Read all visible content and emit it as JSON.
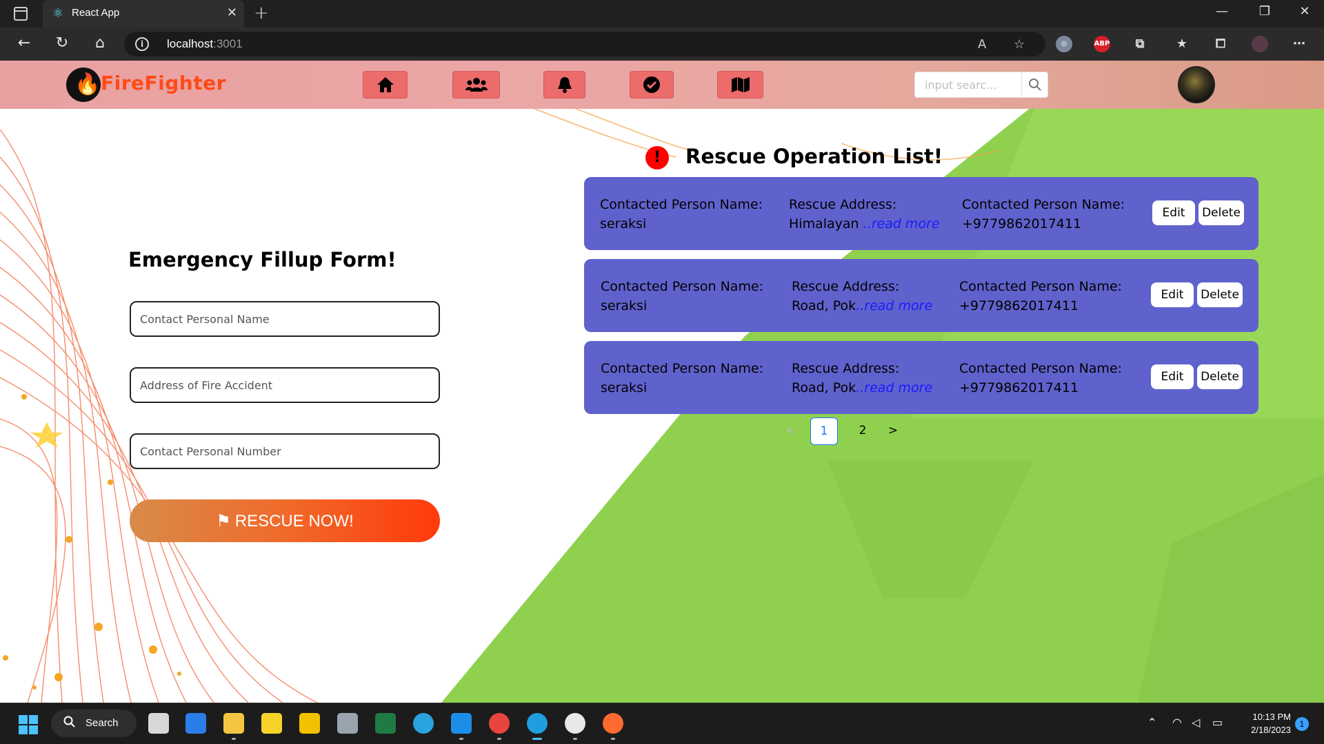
{
  "browser": {
    "tab_title": "React App",
    "url_host": "localhost",
    "url_port": ":3001"
  },
  "app": {
    "logo_text": "FireFighter",
    "nav_items": [
      {
        "name": "home",
        "icon": "home-icon"
      },
      {
        "name": "users",
        "icon": "users-icon"
      },
      {
        "name": "notifications",
        "icon": "bell-icon"
      },
      {
        "name": "tasks",
        "icon": "check-circle-icon"
      },
      {
        "name": "map",
        "icon": "map-icon"
      }
    ],
    "search": {
      "placeholder": "input searc..."
    }
  },
  "form": {
    "title": "Emergency Fillup Form!",
    "name_placeholder": "Contact Personal Name",
    "address_placeholder": "Address of Fire Accident",
    "number_placeholder": "Contact Personal Number",
    "submit_label": "RESCUE NOW!"
  },
  "list": {
    "title": "Rescue Operation List!",
    "items": [
      {
        "name_label": "Contacted Person Name:",
        "name_value": "seraksi",
        "address_label": "Rescue Address:",
        "address_value": "Himalayan ",
        "read_more": "..read more",
        "phone_label": "Contacted Person Name:",
        "phone_value": "+9779862017411",
        "edit_label": "Edit",
        "delete_label": "Delete"
      },
      {
        "name_label": "Contacted Person Name:",
        "name_value": "seraksi",
        "address_label": "Rescue Address:",
        "address_value": "Road, Pok",
        "read_more": "..read more",
        "phone_label": "Contacted Person Name:",
        "phone_value": "+9779862017411",
        "edit_label": "Edit",
        "delete_label": "Delete"
      },
      {
        "name_label": "Contacted Person Name:",
        "name_value": "seraksi",
        "address_label": "Rescue Address:",
        "address_value": "Road, Pok",
        "read_more": "..read more",
        "phone_label": "Contacted Person Name:",
        "phone_value": "+9779862017411",
        "edit_label": "Edit",
        "delete_label": "Delete"
      }
    ],
    "pagination": {
      "prev": "<",
      "pages": [
        "1",
        "2"
      ],
      "current": "1",
      "next": ">"
    }
  },
  "taskbar": {
    "search_label": "Search",
    "time": "10:13 PM",
    "date": "2/18/2023",
    "notification_count": "1"
  },
  "colors": {
    "appbar": "#eba6a6",
    "nav_button": "#ec6b6b",
    "card": "#5f62cc",
    "accent_green": "#8fd14f",
    "rescue_gradient_end": "#ff3a0a"
  }
}
